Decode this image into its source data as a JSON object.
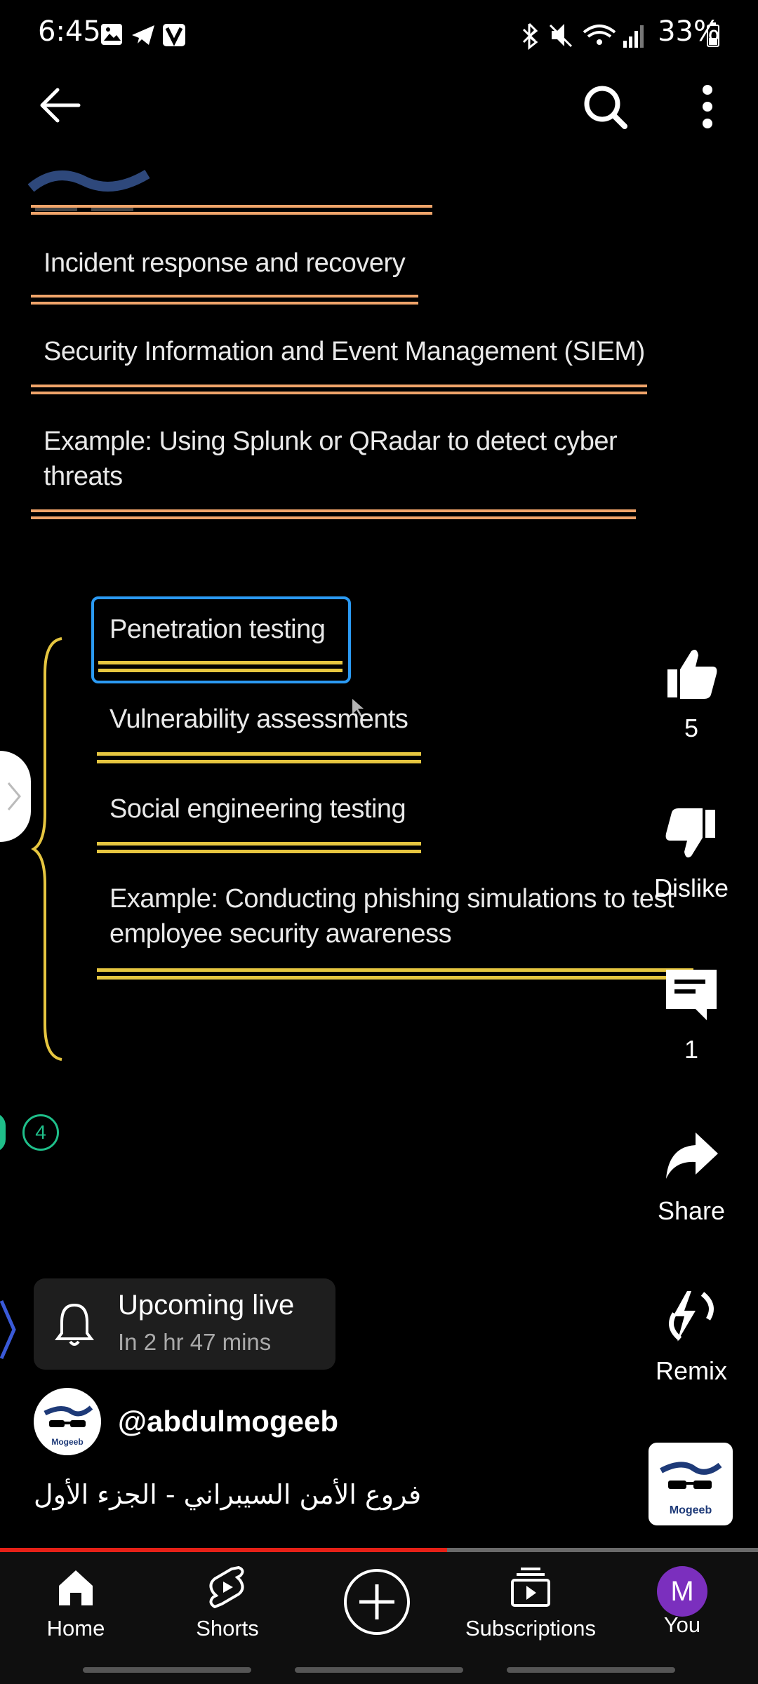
{
  "status_bar": {
    "time": "6:45",
    "battery": "33%"
  },
  "top_bar": {
    "back_icon": "arrow-left-icon",
    "search_icon": "search-icon",
    "more_icon": "more-vertical-icon"
  },
  "slide": {
    "items_top": [
      "Incident response and recovery",
      "Security Information and Event Management (SIEM)",
      "Example: Using Splunk or QRadar to detect cyber",
      "threats"
    ],
    "items_bottom": [
      "Penetration testing",
      "Vulnerability assessments",
      "Social engineering testing",
      "Example: Conducting phishing simulations to test",
      "employee security awareness"
    ],
    "badge": "4"
  },
  "actions": {
    "like_count": "5",
    "dislike_label": "Dislike",
    "comment_count": "1",
    "share_label": "Share",
    "remix_label": "Remix"
  },
  "upcoming": {
    "title": "Upcoming live",
    "subtitle": "In 2 hr 47 mins"
  },
  "channel": {
    "handle": "@abdulmogeeb",
    "logo_text": "Mogeeb"
  },
  "video": {
    "title": "فروع الأمن السيبراني - الجزء الأول",
    "progress": 0.59
  },
  "nav": {
    "home": "Home",
    "shorts": "Shorts",
    "subscriptions": "Subscriptions",
    "you": "You",
    "avatar_letter": "M"
  },
  "colors": {
    "progress_red": "#e62117",
    "avatar_purple": "#7b2fbe",
    "orange_line": "#f0a46a",
    "yellow_line": "#e6c640",
    "highlight_blue": "#2b9af3"
  }
}
